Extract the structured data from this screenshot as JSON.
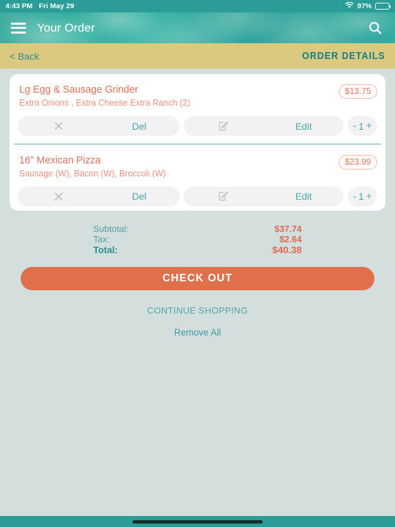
{
  "status_bar": {
    "time": "4:43 PM",
    "date": "Fri May 29",
    "battery_percent": "97%",
    "wifi_icon": "wifi-icon",
    "battery_icon": "battery-icon"
  },
  "header": {
    "menu_icon": "hamburger-menu-icon",
    "title": "Your Order",
    "search_icon": "search-icon"
  },
  "sub_header": {
    "back_label": "< Back",
    "title": "ORDER DETAILS"
  },
  "order": {
    "items": [
      {
        "name": "Lg Egg & Sausage Grinder",
        "options": "Extra Onions , Extra Cheese Extra Ranch (2)",
        "price": "$13.75",
        "delete_label": "Del",
        "delete_icon": "close-x-icon",
        "edit_label": "Edit",
        "edit_icon": "pencil-square-icon",
        "minus_label": "-",
        "quantity": "1",
        "plus_label": "+"
      },
      {
        "name": "16\" Mexican Pizza",
        "options": "Sausage (W), Bacon (W), Broccoli (W)",
        "price": "$23.99",
        "delete_label": "Del",
        "delete_icon": "close-x-icon",
        "edit_label": "Edit",
        "edit_icon": "pencil-square-icon",
        "minus_label": "-",
        "quantity": "1",
        "plus_label": "+"
      }
    ]
  },
  "totals": {
    "subtotal_label": "Subtotal:",
    "subtotal_value": "$37.74",
    "tax_label": "Tax:",
    "tax_value": "$2.64",
    "total_label": "Total:",
    "total_value": "$40.38"
  },
  "actions": {
    "checkout_label": "CHECK OUT",
    "continue_label": "CONTINUE SHOPPING",
    "remove_all_label": "Remove All"
  },
  "colors": {
    "teal": "#2a9d96",
    "gold": "#dbc97f",
    "orange": "#e06f4c",
    "page_bg": "#d3dfdf",
    "accent_text": "#e3705a"
  }
}
